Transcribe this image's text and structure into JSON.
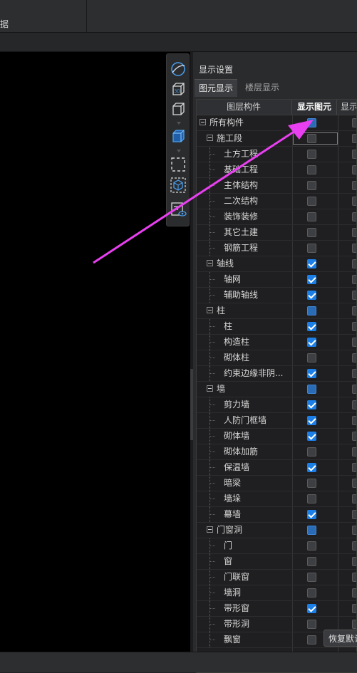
{
  "top": {
    "menu_fragment": "据"
  },
  "panel": {
    "title": "显示设置",
    "tabs": [
      {
        "label": "图元显示",
        "active": true
      },
      {
        "label": "楼层显示",
        "active": false
      }
    ],
    "headers": {
      "layer": "图层构件",
      "show_element": "显示图元",
      "show_name": "显示"
    },
    "rows": [
      {
        "label": "所有构件",
        "level": 0,
        "expandable": true,
        "show": "partial",
        "focused": false
      },
      {
        "label": "施工段",
        "level": 1,
        "expandable": true,
        "show": "off",
        "focused": true
      },
      {
        "label": "土方工程",
        "level": 2,
        "show": "off"
      },
      {
        "label": "基础工程",
        "level": 2,
        "show": "off"
      },
      {
        "label": "主体结构",
        "level": 2,
        "show": "off"
      },
      {
        "label": "二次结构",
        "level": 2,
        "show": "off"
      },
      {
        "label": "装饰装修",
        "level": 2,
        "show": "off"
      },
      {
        "label": "其它土建",
        "level": 2,
        "show": "off"
      },
      {
        "label": "钢筋工程",
        "level": 2,
        "show": "off"
      },
      {
        "label": "轴线",
        "level": 1,
        "expandable": true,
        "show": "on"
      },
      {
        "label": "轴网",
        "level": 2,
        "show": "on"
      },
      {
        "label": "辅助轴线",
        "level": 2,
        "show": "on"
      },
      {
        "label": "柱",
        "level": 1,
        "expandable": true,
        "show": "partial"
      },
      {
        "label": "柱",
        "level": 2,
        "show": "on"
      },
      {
        "label": "构造柱",
        "level": 2,
        "show": "on"
      },
      {
        "label": "砌体柱",
        "level": 2,
        "show": "off"
      },
      {
        "label": "约束边缘非阴...",
        "level": 2,
        "show": "on"
      },
      {
        "label": "墙",
        "level": 1,
        "expandable": true,
        "show": "partial"
      },
      {
        "label": "剪力墙",
        "level": 2,
        "show": "on"
      },
      {
        "label": "人防门框墙",
        "level": 2,
        "show": "on"
      },
      {
        "label": "砌体墙",
        "level": 2,
        "show": "on"
      },
      {
        "label": "砌体加筋",
        "level": 2,
        "show": "off"
      },
      {
        "label": "保温墙",
        "level": 2,
        "show": "on"
      },
      {
        "label": "暗梁",
        "level": 2,
        "show": "off"
      },
      {
        "label": "墙垛",
        "level": 2,
        "show": "off"
      },
      {
        "label": "幕墙",
        "level": 2,
        "show": "on"
      },
      {
        "label": "门窗洞",
        "level": 1,
        "expandable": true,
        "show": "partial"
      },
      {
        "label": "门",
        "level": 2,
        "show": "off"
      },
      {
        "label": "窗",
        "level": 2,
        "show": "off"
      },
      {
        "label": "门联窗",
        "level": 2,
        "show": "off"
      },
      {
        "label": "墙洞",
        "level": 2,
        "show": "off"
      },
      {
        "label": "带形窗",
        "level": 2,
        "show": "on"
      },
      {
        "label": "带形洞",
        "level": 2,
        "show": "off"
      },
      {
        "label": "飘窗",
        "level": 2,
        "show": "off"
      }
    ],
    "restore_button": "恢复默认"
  },
  "view_tools": [
    "orbit-icon",
    "3d-view-icon",
    "box-view-icon",
    "box-solid-icon",
    "select-region-icon",
    "isolate-icon",
    "display-settings-icon"
  ],
  "colors": {
    "accent": "#1c7fe8",
    "annotation_arrow": "#e83ff0"
  }
}
